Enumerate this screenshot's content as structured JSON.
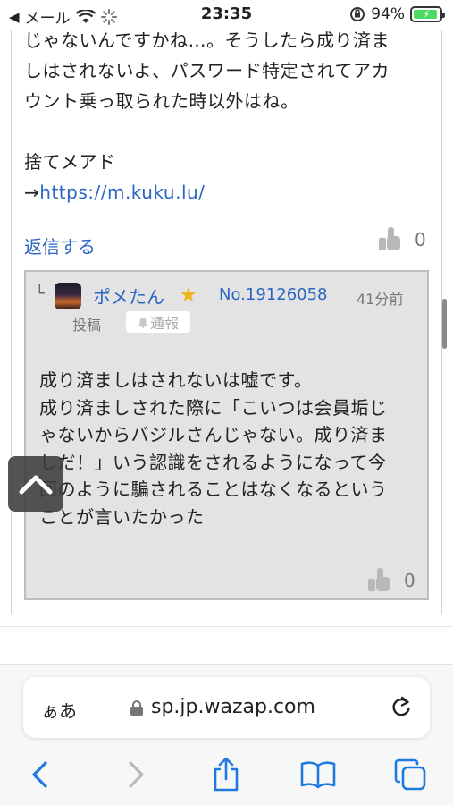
{
  "status_bar": {
    "back_app": "メール",
    "time": "23:35",
    "battery_percent": "94%",
    "battery_level": 0.94
  },
  "post": {
    "lines": [
      "じゃないんですかね…。そうしたら成り済ま",
      "しはされないよ、パスワード特定されてアカ",
      "ウント乗っ取られた時以外はね。",
      "捨てメアド"
    ],
    "link_prefix": "→",
    "link_url": "https://m.kuku.lu/",
    "reply_label": "返信する",
    "like_count": "0"
  },
  "reply": {
    "corner": "└",
    "user_name": "ポメたん",
    "badge_level": "4",
    "post_number": "No.19126058",
    "time_ago": "41分前",
    "post_label": "投稿",
    "report_label": "通報",
    "body_lines": [
      "成り済ましはされないは嘘です。",
      "成り済ましされた際に「こいつは会員垢じ",
      "ゃないからバジルさんじゃない。成り済ま",
      "しだ！」いう認識をされるようになって今",
      "回のように騙されることはなくなるという",
      "ことが言いたかった"
    ],
    "like_count": "0"
  },
  "browser": {
    "aa_label": "ぁあ",
    "url": "sp.jp.wazap.com"
  },
  "colors": {
    "link": "#2a66c4",
    "safari_blue": "#1f7ae0",
    "reply_bg": "#e3e3e3",
    "badge": "#f0b21b"
  }
}
